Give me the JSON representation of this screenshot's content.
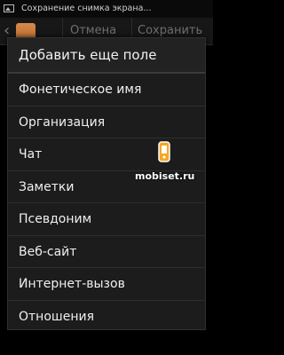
{
  "status_bar": {
    "notification": "Сохранение снимка экрана..."
  },
  "app_bar": {
    "cancel_label": "Отмена",
    "save_label": "Сохранить"
  },
  "dialog": {
    "title": "Добавить еще поле",
    "items": [
      "Фонетическое имя",
      "Организация",
      "Чат",
      "Заметки",
      "Псевдоним",
      "Веб-сайт",
      "Интернет-вызов",
      "Отношения"
    ]
  },
  "watermark": {
    "text": "mobiset.ru"
  },
  "colors": {
    "accent": "#f5a623",
    "background": "#000000",
    "dialog": "#1c1c1c"
  }
}
